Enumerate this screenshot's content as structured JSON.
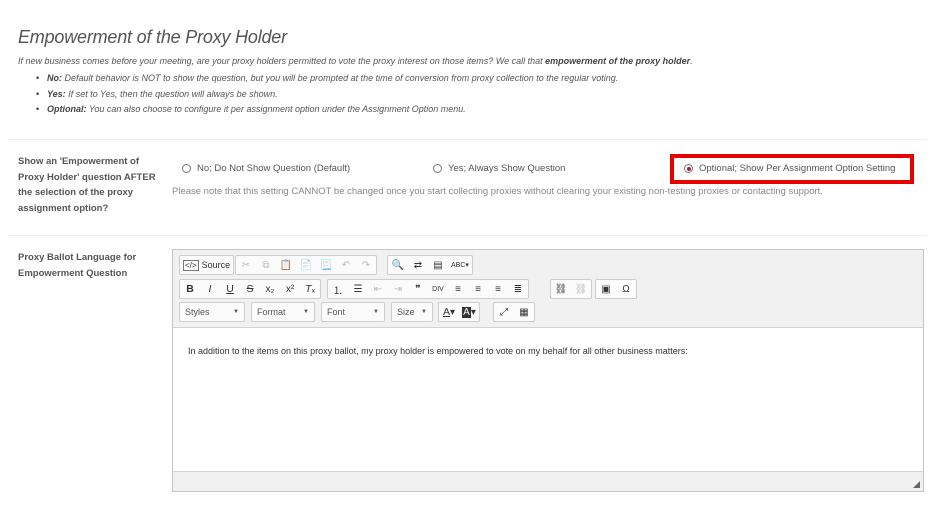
{
  "section": {
    "title": "Empowerment of the Proxy Holder",
    "intro_prefix": "If new business comes before your meeting, are your proxy holders permitted to vote the proxy interest on those items? We call that ",
    "intro_bold": "empowerment of the proxy holder",
    "intro_suffix": ".",
    "bullets": [
      {
        "key": "No:",
        "text": " Default behavior is NOT to show the question, but you will be prompted at the time of conversion from proxy collection to the regular voting."
      },
      {
        "key": "Yes:",
        "text": " If set to Yes, then the question will always be shown."
      },
      {
        "key": "Optional:",
        "text": " You can also choose to configure it per assignment option under the Assignment Option menu."
      }
    ]
  },
  "question": {
    "label_lines": [
      "Show an 'Empowerment of",
      "Proxy Holder' question AFTER",
      "the selection of the proxy",
      "assignment option?"
    ],
    "options": [
      {
        "label": "No; Do Not Show Question (Default)",
        "selected": false
      },
      {
        "label": "Yes; Always Show Question",
        "selected": false
      },
      {
        "label": "Optional; Show Per Assignment Option Setting",
        "selected": true
      }
    ],
    "note": "Please note that this setting CANNOT be changed once you start collecting proxies without clearing your existing non-testing proxies or contacting support.",
    "highlight_color": "#e60000"
  },
  "ballot": {
    "label_lines": [
      "Proxy Ballot Language for",
      "Empowerment Question"
    ],
    "editor": {
      "source_label": "Source",
      "styles_label": "Styles",
      "format_label": "Format",
      "font_label": "Font",
      "size_label": "Size",
      "content": "In addition to the items on this proxy ballot, my proxy holder is empowered to vote on my behalf for all other business matters:"
    }
  }
}
